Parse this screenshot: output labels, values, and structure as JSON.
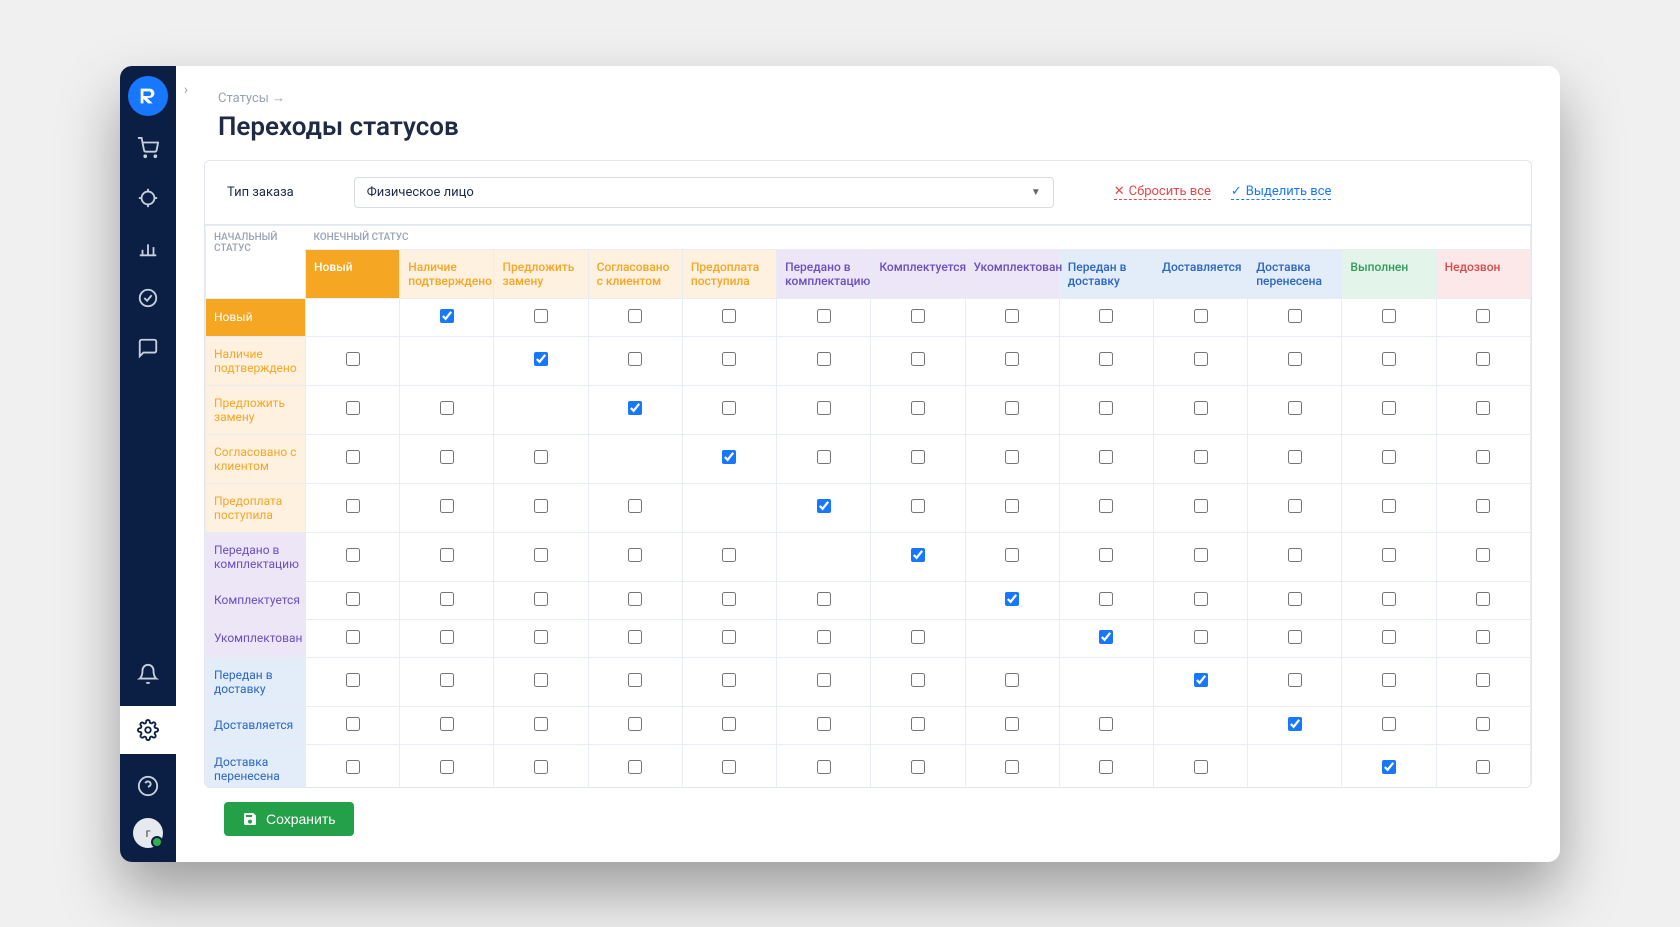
{
  "sidebar": {
    "logo_letter": "R",
    "icons": [
      {
        "name": "cart-icon"
      },
      {
        "name": "target-icon"
      },
      {
        "name": "chart-icon"
      },
      {
        "name": "check-circle-icon"
      },
      {
        "name": "chat-icon"
      }
    ],
    "bottom_icons": [
      {
        "name": "bell-icon"
      },
      {
        "name": "gear-icon",
        "active": true
      },
      {
        "name": "help-icon"
      }
    ],
    "avatar_initial": "г"
  },
  "breadcrumb": "Статусы →",
  "page_title": "Переходы статусов",
  "filter": {
    "label": "Тип заказа",
    "selected": "Физическое лицо"
  },
  "actions": {
    "reset": "Сбросить все",
    "select_all": "Выделить все"
  },
  "table": {
    "row_header_label": "НАЧАЛЬНЫЙ СТАТУС",
    "col_header_label": "КОНЕЧНЫЙ СТАТУС",
    "statuses": [
      {
        "label": "Новый",
        "color": "#f5a623",
        "text": "#ffffff",
        "row_bg": "#f5a623",
        "row_text": "#ffffff"
      },
      {
        "label": "Наличие подтверждено",
        "color": "#fff1e0",
        "text": "#f5a623",
        "row_bg": "#fff1e0",
        "row_text": "#f5a623"
      },
      {
        "label": "Предложить замену",
        "color": "#fff1e0",
        "text": "#f5a623",
        "row_bg": "#fff1e0",
        "row_text": "#f5a623"
      },
      {
        "label": "Согласовано с клиентом",
        "color": "#fff1e0",
        "text": "#f5a623",
        "row_bg": "#fff1e0",
        "row_text": "#f5a623"
      },
      {
        "label": "Предоплата поступила",
        "color": "#fff1e0",
        "text": "#f5a623",
        "row_bg": "#fff1e0",
        "row_text": "#f5a623"
      },
      {
        "label": "Передано в комплектацию",
        "color": "#ece6f7",
        "text": "#6b4fc0",
        "row_bg": "#ece6f7",
        "row_text": "#6b4fc0"
      },
      {
        "label": "Комплектуется",
        "color": "#ece6f7",
        "text": "#6b4fc0",
        "row_bg": "#ece6f7",
        "row_text": "#6b4fc0"
      },
      {
        "label": "Укомплектован",
        "color": "#ece6f7",
        "text": "#6b4fc0",
        "row_bg": "#ece6f7",
        "row_text": "#6b4fc0"
      },
      {
        "label": "Передан в доставку",
        "color": "#e3ecf9",
        "text": "#2a66c2",
        "row_bg": "#e3ecf9",
        "row_text": "#2a66c2"
      },
      {
        "label": "Доставляется",
        "color": "#e3ecf9",
        "text": "#2a66c2",
        "row_bg": "#e3ecf9",
        "row_text": "#2a66c2"
      },
      {
        "label": "Доставка перенесена",
        "color": "#e3ecf9",
        "text": "#2a66c2",
        "row_bg": "#e3ecf9",
        "row_text": "#2a66c2"
      },
      {
        "label": "Выполнен",
        "color": "#e3f5ea",
        "text": "#2f9b58",
        "row_bg": "#e3f5ea",
        "row_text": "#2f9b58"
      },
      {
        "label": "Недозвон",
        "color": "#fce8e8",
        "text": "#d64b4b",
        "row_bg": "#fce8e8",
        "row_text": "#d64b4b"
      }
    ],
    "matrix": [
      [
        null,
        1,
        0,
        0,
        0,
        0,
        0,
        0,
        0,
        0,
        0,
        0,
        0
      ],
      [
        0,
        null,
        1,
        0,
        0,
        0,
        0,
        0,
        0,
        0,
        0,
        0,
        0
      ],
      [
        0,
        0,
        null,
        1,
        0,
        0,
        0,
        0,
        0,
        0,
        0,
        0,
        0
      ],
      [
        0,
        0,
        0,
        null,
        1,
        0,
        0,
        0,
        0,
        0,
        0,
        0,
        0
      ],
      [
        0,
        0,
        0,
        0,
        null,
        1,
        0,
        0,
        0,
        0,
        0,
        0,
        0
      ],
      [
        0,
        0,
        0,
        0,
        0,
        null,
        1,
        0,
        0,
        0,
        0,
        0,
        0
      ],
      [
        0,
        0,
        0,
        0,
        0,
        0,
        null,
        1,
        0,
        0,
        0,
        0,
        0
      ],
      [
        0,
        0,
        0,
        0,
        0,
        0,
        0,
        null,
        1,
        0,
        0,
        0,
        0
      ],
      [
        0,
        0,
        0,
        0,
        0,
        0,
        0,
        0,
        null,
        1,
        0,
        0,
        0
      ],
      [
        0,
        0,
        0,
        0,
        0,
        0,
        0,
        0,
        0,
        null,
        1,
        0,
        0
      ],
      [
        0,
        0,
        0,
        0,
        0,
        0,
        0,
        0,
        0,
        0,
        null,
        1,
        0
      ],
      [
        0,
        0,
        0,
        0,
        0,
        0,
        0,
        0,
        0,
        0,
        0,
        null,
        1
      ]
    ]
  },
  "save_button": "Сохранить"
}
